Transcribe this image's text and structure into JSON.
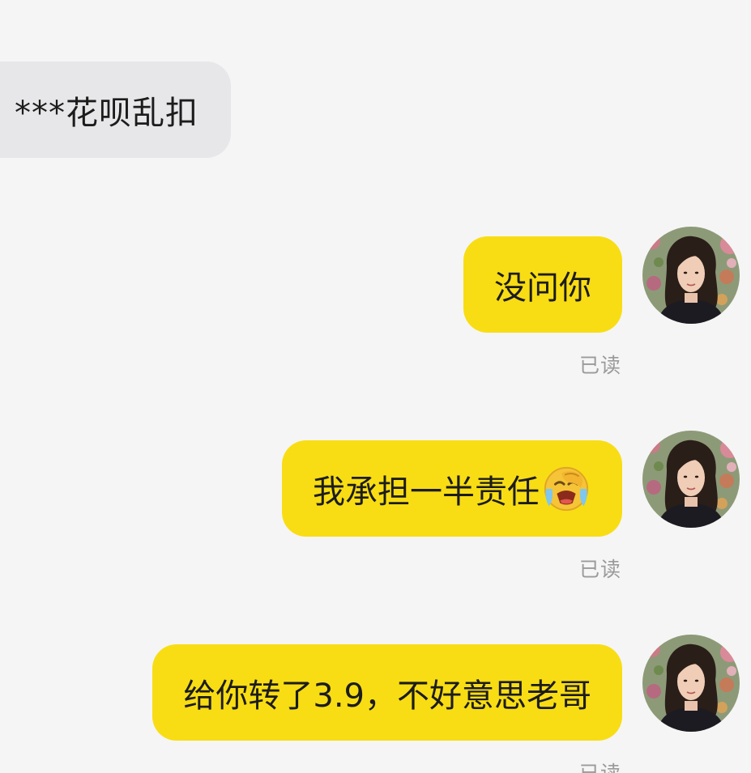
{
  "conversation": {
    "incoming": [
      {
        "text": "***花呗乱扣"
      }
    ],
    "outgoing": [
      {
        "text": "没问你",
        "status": "已读"
      },
      {
        "text": "我承担一半责任",
        "emoji": "loudly-crying-face-icon",
        "status": "已读"
      },
      {
        "text": "给你转了3.9，不好意思老哥",
        "status": "已读"
      }
    ]
  },
  "colors": {
    "background": "#f5f5f5",
    "incoming_bubble": "#e7e7e9",
    "outgoing_bubble": "#f8dd14",
    "read_status": "#9a9a9a"
  },
  "icons": {
    "avatar": "user-avatar-photo"
  }
}
